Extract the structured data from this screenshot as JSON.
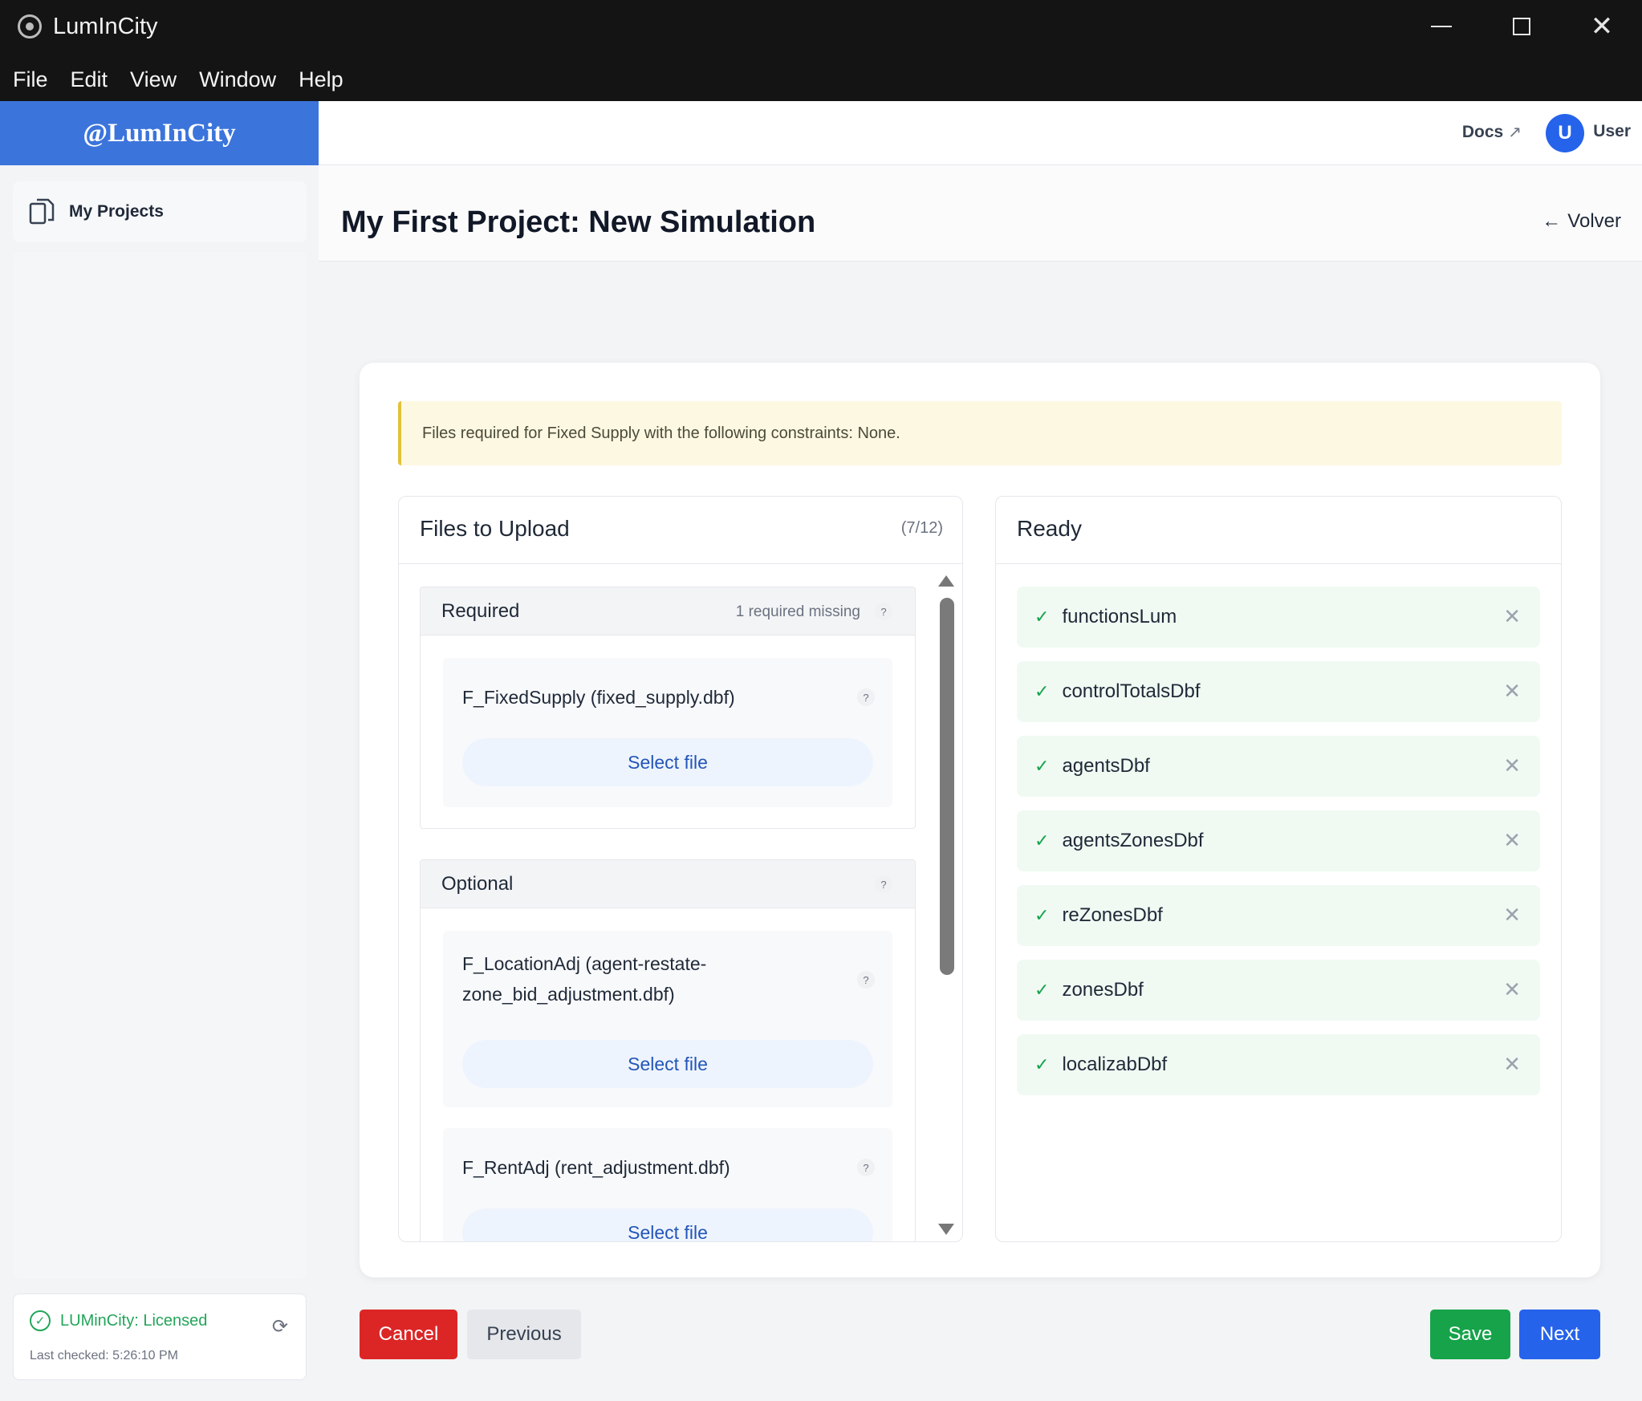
{
  "window": {
    "title": "LumInCity",
    "menu": [
      "File",
      "Edit",
      "View",
      "Window",
      "Help"
    ]
  },
  "sidebar": {
    "brand": "@LumInCity",
    "items": [
      {
        "label": "My Projects",
        "icon": "documents-icon"
      }
    ],
    "license": {
      "label": "LUMinCity: Licensed",
      "last_checked": "Last checked: 5:26:10 PM"
    }
  },
  "header": {
    "docs": "Docs",
    "avatar_initial": "U",
    "user": "User"
  },
  "page": {
    "title": "My First Project: New Simulation",
    "back": "Volver"
  },
  "notice": "Files required for Fixed Supply with the following constraints: None.",
  "upload": {
    "title": "Files to Upload",
    "count": "(7/12)",
    "required": {
      "title": "Required",
      "missing": "1 required missing",
      "files": [
        {
          "name": "F_FixedSupply (fixed_supply.dbf)",
          "button": "Select file"
        }
      ]
    },
    "optional": {
      "title": "Optional",
      "files": [
        {
          "name": "F_LocationAdj (agent-restate-zone_bid_adjustment.dbf)",
          "button": "Select file"
        },
        {
          "name": "F_RentAdj (rent_adjustment.dbf)",
          "button": "Select file"
        }
      ]
    },
    "help_glyph": "?"
  },
  "ready": {
    "title": "Ready",
    "items": [
      "functionsLum",
      "controlTotalsDbf",
      "agentsDbf",
      "agentsZonesDbf",
      "reZonesDbf",
      "zonesDbf",
      "localizabDbf"
    ]
  },
  "footer": {
    "cancel": "Cancel",
    "previous": "Previous",
    "save": "Save",
    "next": "Next"
  },
  "colors": {
    "brand_blue": "#3b74db",
    "success": "#16a34a",
    "danger": "#dc2626",
    "primary": "#2563eb"
  }
}
